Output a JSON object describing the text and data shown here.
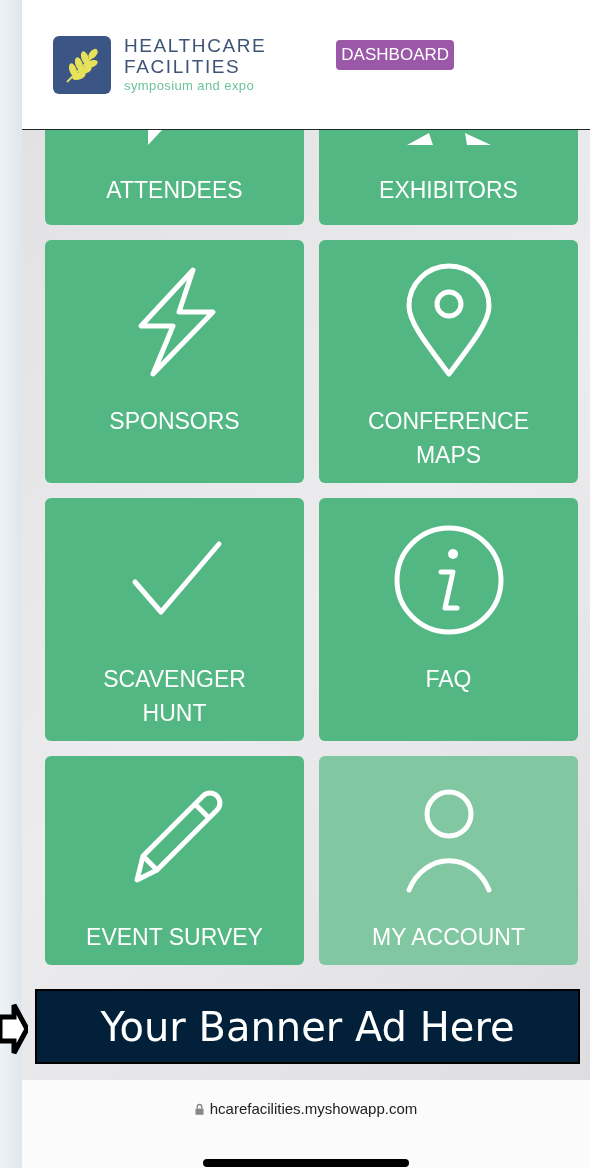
{
  "header": {
    "brand_line_1": "HEALTHCARE",
    "brand_line_2": "FACILITIES",
    "brand_tagline": "symposium and expo",
    "dashboard_button": "DASHBOARD"
  },
  "tiles": [
    {
      "label": "ATTENDEES",
      "kind": "bubble",
      "selected": false
    },
    {
      "label": "EXHIBITORS",
      "kind": "star",
      "selected": false
    },
    {
      "label": "SPONSORS",
      "kind": "bolt",
      "selected": false
    },
    {
      "label": "CONFERENCE MAPS",
      "kind": "pin",
      "selected": false
    },
    {
      "label": "SCAVENGER HUNT",
      "kind": "check",
      "selected": false
    },
    {
      "label": "FAQ",
      "kind": "info",
      "selected": false
    },
    {
      "label": "EVENT SURVEY",
      "kind": "pencil",
      "selected": false
    },
    {
      "label": "MY ACCOUNT",
      "kind": "person",
      "selected": true
    }
  ],
  "banner": {
    "text": "Your Banner Ad Here"
  },
  "address_bar": {
    "url": "hcarefacilities.myshowapp.com"
  }
}
